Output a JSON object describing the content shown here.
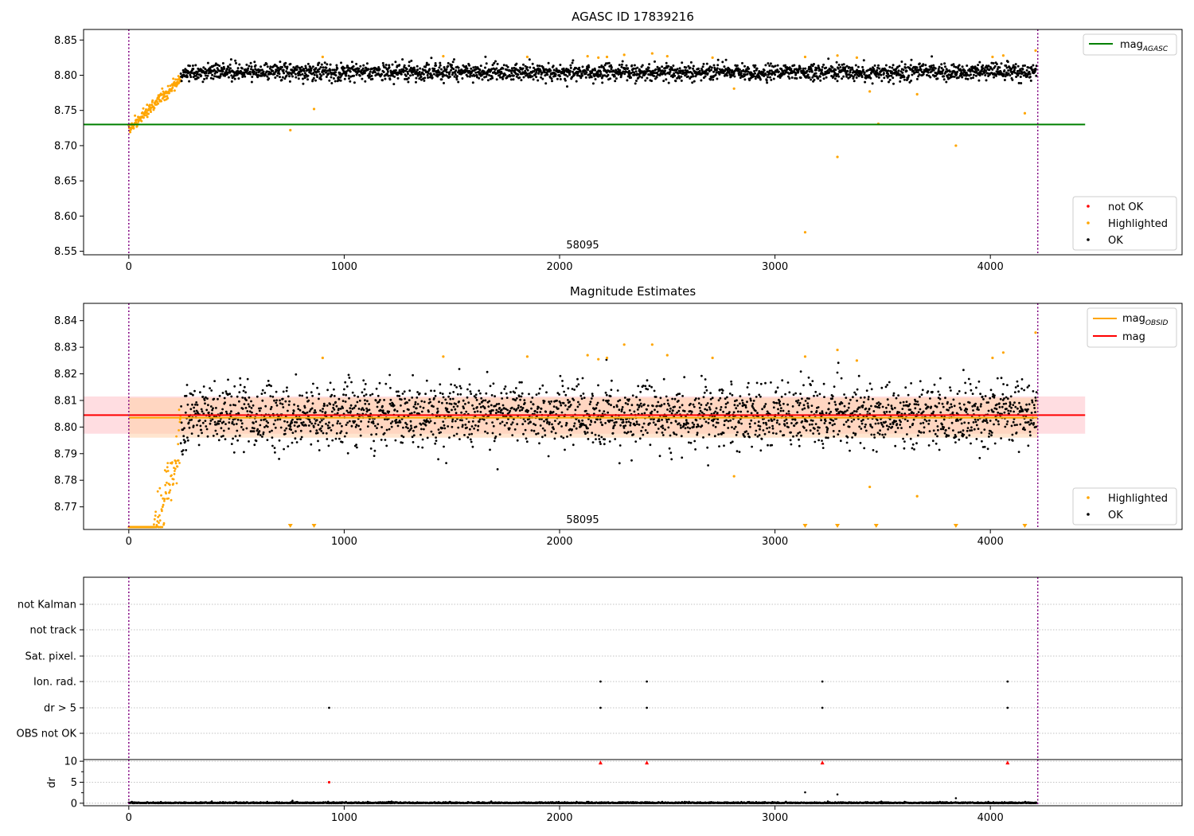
{
  "chart_data": [
    {
      "type": "scatter",
      "title": "AGASC ID 17839216",
      "xlim": [
        -210,
        4890
      ],
      "ylim": [
        8.545,
        8.865
      ],
      "xticks": [
        "0",
        "1000",
        "2000",
        "3000",
        "4000"
      ],
      "yticks": [
        "8.55",
        "8.60",
        "8.65",
        "8.70",
        "8.75",
        "8.80",
        "8.85"
      ],
      "obsid_label": "58095",
      "obs_boundaries": [
        0,
        4220
      ],
      "line": {
        "name": "mag",
        "subscript": "AGASC",
        "y": 8.73,
        "x": [
          -210,
          4440
        ],
        "color": "#008000"
      },
      "legend_points": [
        {
          "name": "not OK",
          "color": "#ff0000"
        },
        {
          "name": "Highlighted",
          "color": "#ffa500"
        },
        {
          "name": "OK",
          "color": "#000000"
        }
      ],
      "outliers": [
        [
          750,
          8.722
        ],
        [
          860,
          8.752
        ],
        [
          900,
          8.826
        ],
        [
          1460,
          8.827
        ],
        [
          1850,
          8.826
        ],
        [
          2130,
          8.827
        ],
        [
          2180,
          8.825
        ],
        [
          2220,
          8.826
        ],
        [
          2300,
          8.829
        ],
        [
          2430,
          8.831
        ],
        [
          2500,
          8.827
        ],
        [
          2710,
          8.825
        ],
        [
          2810,
          8.781
        ],
        [
          3140,
          8.577
        ],
        [
          3140,
          8.826
        ],
        [
          3290,
          8.684
        ],
        [
          3290,
          8.828
        ],
        [
          3380,
          8.825
        ],
        [
          3440,
          8.777
        ],
        [
          3480,
          8.731
        ],
        [
          3660,
          8.773
        ],
        [
          3840,
          8.7
        ],
        [
          4010,
          8.826
        ],
        [
          4060,
          8.828
        ],
        [
          4160,
          8.746
        ],
        [
          4210,
          8.835
        ]
      ]
    },
    {
      "type": "scatter",
      "title": "Magnitude Estimates",
      "xlim": [
        -210,
        4890
      ],
      "ylim": [
        8.7615,
        8.8465
      ],
      "xticks": [
        "0",
        "1000",
        "2000",
        "3000",
        "4000"
      ],
      "yticks": [
        "8.77",
        "8.78",
        "8.79",
        "8.80",
        "8.81",
        "8.82",
        "8.83",
        "8.84"
      ],
      "obsid_label": "58095",
      "obs_boundaries": [
        0,
        4220
      ],
      "lines": [
        {
          "name": "mag",
          "subscript": "OBSID",
          "y": 8.8035,
          "color": "#ffa500"
        },
        {
          "name": "mag",
          "subscript": "",
          "y": 8.8045,
          "color": "#ff0000"
        }
      ],
      "bands": [
        {
          "y0": 8.7975,
          "y1": 8.8115,
          "x": [
            -210,
            4440
          ],
          "color": "#ffb3bd"
        },
        {
          "y0": 8.796,
          "y1": 8.811,
          "x": [
            0,
            4220
          ],
          "color": "#ffd0a8"
        }
      ],
      "legend_points": [
        {
          "name": "Highlighted",
          "color": "#ffa500"
        },
        {
          "name": "OK",
          "color": "#000000"
        }
      ],
      "clipped_markers_x": [
        750,
        860,
        3140,
        3290,
        3470,
        3840,
        4160
      ],
      "outliers": [
        [
          900,
          8.826
        ],
        [
          1460,
          8.8265
        ],
        [
          1850,
          8.8265
        ],
        [
          2130,
          8.827
        ],
        [
          2180,
          8.8255
        ],
        [
          2220,
          8.826
        ],
        [
          2300,
          8.831
        ],
        [
          2430,
          8.831
        ],
        [
          2500,
          8.827
        ],
        [
          2710,
          8.826
        ],
        [
          2810,
          8.7815
        ],
        [
          3140,
          8.8265
        ],
        [
          3290,
          8.829
        ],
        [
          3380,
          8.825
        ],
        [
          3440,
          8.7775
        ],
        [
          3660,
          8.774
        ],
        [
          4010,
          8.826
        ],
        [
          4060,
          8.828
        ],
        [
          4210,
          8.8355
        ]
      ]
    },
    {
      "type": "scatter",
      "title": "",
      "xlim": [
        -210,
        4890
      ],
      "xticks": [
        "0",
        "1000",
        "2000",
        "3000",
        "4000"
      ],
      "obs_boundaries": [
        0,
        4220
      ],
      "flag_categories": [
        "not Kalman",
        "not track",
        "Sat. pixel.",
        "Ion. rad.",
        "dr > 5",
        "OBS not OK"
      ],
      "flag_points": [
        {
          "category": "Ion. rad.",
          "x": [
            2190,
            2405,
            3220,
            4080
          ]
        },
        {
          "category": "dr > 5",
          "x": [
            930,
            2190,
            2405,
            3220,
            4080
          ]
        }
      ]
    },
    {
      "type": "scatter",
      "title": "",
      "xlim": [
        -210,
        4890
      ],
      "ylim": [
        -0.6,
        10.4
      ],
      "ylabel": "dr",
      "yticks": [
        "0",
        "5",
        "10"
      ],
      "obs_boundaries": [
        0,
        4220
      ],
      "clipped_points_x": [
        2190,
        2405,
        3220,
        4080
      ],
      "red_points": [
        [
          930,
          5.0
        ]
      ],
      "outliers": [
        [
          3140,
          2.6
        ],
        [
          3290,
          2.1
        ],
        [
          3840,
          1.2
        ],
        [
          760,
          0.6
        ]
      ]
    }
  ],
  "colors": {
    "ok": "#000000",
    "highlighted": "#ffa500",
    "not_ok": "#ff0000",
    "boundary": "#800080",
    "agasc_line": "#008000"
  }
}
